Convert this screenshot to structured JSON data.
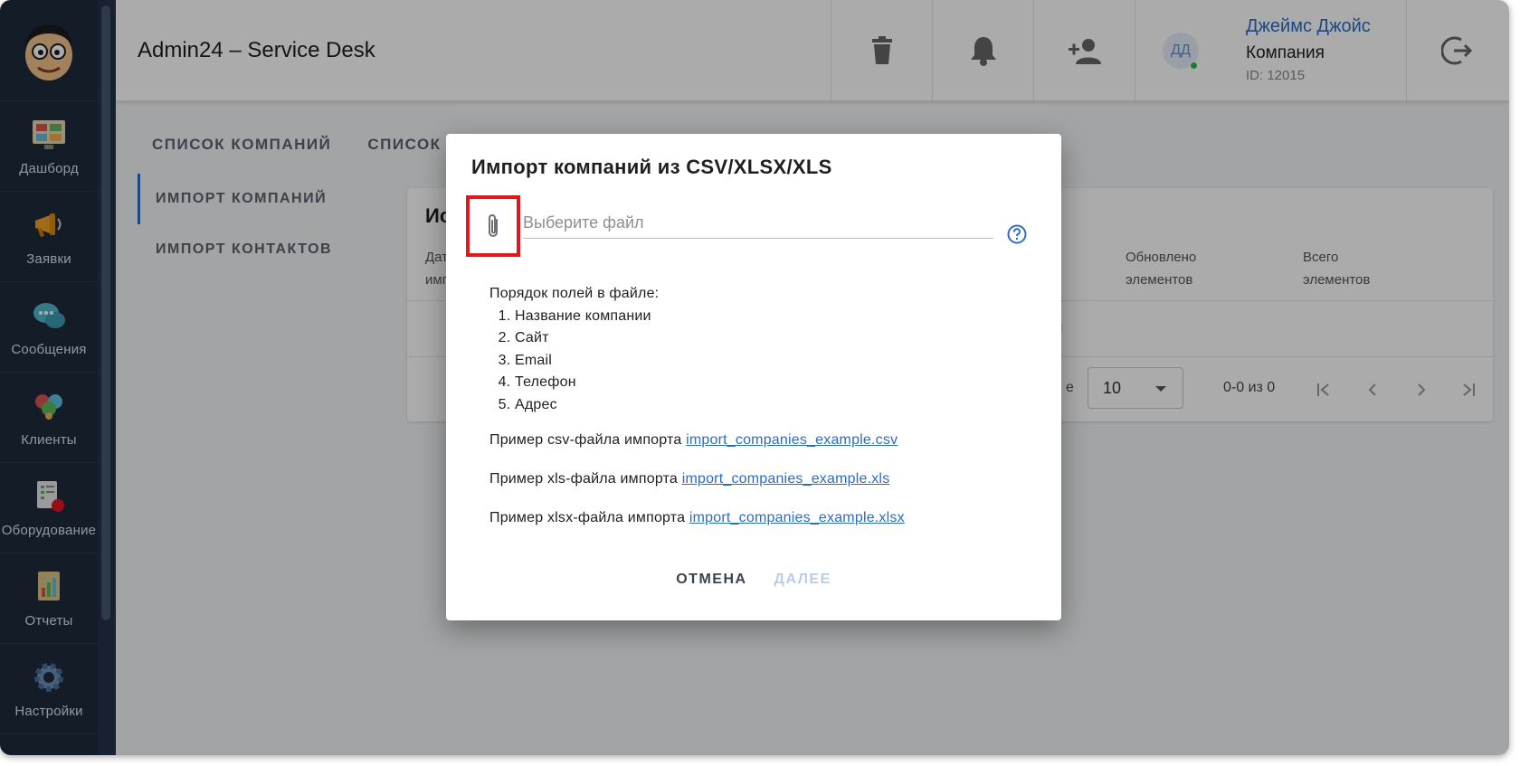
{
  "app": {
    "title": "Admin24 – Service Desk"
  },
  "sidebar": {
    "items": [
      {
        "label": "Дашборд",
        "icon": "dashboard-icon"
      },
      {
        "label": "Заявки",
        "icon": "megaphone-icon"
      },
      {
        "label": "Сообщения",
        "icon": "chat-bubbles-icon"
      },
      {
        "label": "Клиенты",
        "icon": "clients-icon"
      },
      {
        "label": "Оборудование",
        "icon": "equipment-icon"
      },
      {
        "label": "Отчеты",
        "icon": "reports-icon"
      },
      {
        "label": "Настройки",
        "icon": "settings-gear-icon"
      }
    ]
  },
  "header": {
    "user": {
      "initials": "ДД",
      "name": "Джеймс Джойс",
      "role": "Компания",
      "id": "ID: 12015"
    }
  },
  "tabs": [
    "СПИСОК КОМПАНИЙ",
    "СПИСОК КО"
  ],
  "subnav": [
    "ИМПОРТ КОМПАНИЙ",
    "ИМПОРТ КОНТАКТОВ"
  ],
  "card": {
    "title": "Ис",
    "col_left_1": "Дат",
    "col_left_2": "имп",
    "col_updated_1": "Обновлено",
    "col_updated_2": "элементов",
    "col_total_1": "Всего",
    "col_total_2": "элементов",
    "row_fragment": "н",
    "pager_label_fragment": "е",
    "pager_per_page": "10",
    "pager_range": "0-0 из 0"
  },
  "dialog": {
    "title": "Импорт компаний из CSV/XLSX/XLS",
    "file_placeholder": "Выберите файл",
    "fields_heading": "Порядок полей в файле:",
    "fields": [
      "Название компании",
      "Сайт",
      "Email",
      "Телефон",
      "Адрес"
    ],
    "examples": [
      {
        "text": "Пример csv-файла импорта ",
        "link": "import_companies_example.csv"
      },
      {
        "text": "Пример xls-файла импорта ",
        "link": "import_companies_example.xls"
      },
      {
        "text": "Пример xlsx-файла импорта ",
        "link": "import_companies_example.xlsx"
      }
    ],
    "cancel_label": "ОТМЕНА",
    "next_label": "ДАЛЕЕ"
  },
  "colors": {
    "accent": "#2b6cc4",
    "highlight": "#e5161b",
    "sidebar": "#1f2b3d"
  }
}
